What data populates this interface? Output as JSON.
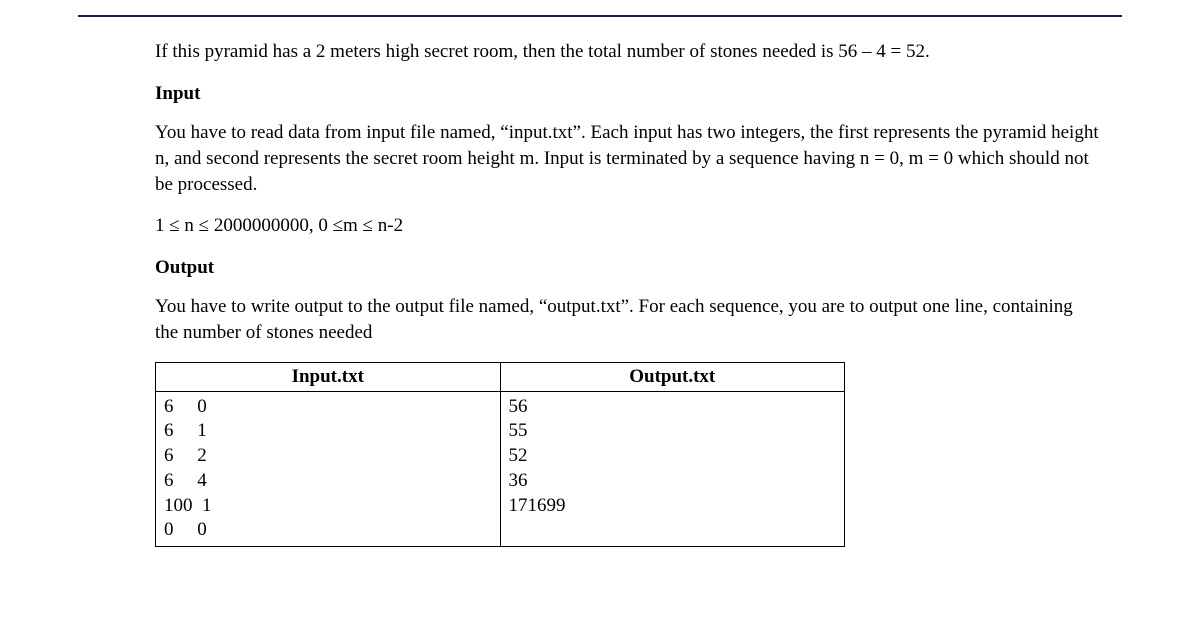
{
  "intro": "If this pyramid has a 2 meters high secret room, then the total number of stones needed is 56 – 4 = 52.",
  "input_heading": "Input",
  "input_desc": "You have to read data from input file named, “input.txt”. Each input has two integers, the first represents the pyramid height n, and second represents the secret  room height m. Input is terminated by a sequence having n = 0, m = 0 which should not be processed.",
  "constraint": "1 ≤ n ≤ 2000000000, 0 ≤m ≤  n-2",
  "output_heading": "Output",
  "output_desc": "You have to write output to the output file named, “output.txt”. For each sequence, you are to output one line, containing the number of stones needed",
  "table": {
    "headers": {
      "input": "Input.txt",
      "output": "Output.txt"
    },
    "input_text": "6     0\n6     1\n6     2\n6     4\n100  1\n0     0",
    "output_text": "56\n55\n52\n36\n171699"
  }
}
